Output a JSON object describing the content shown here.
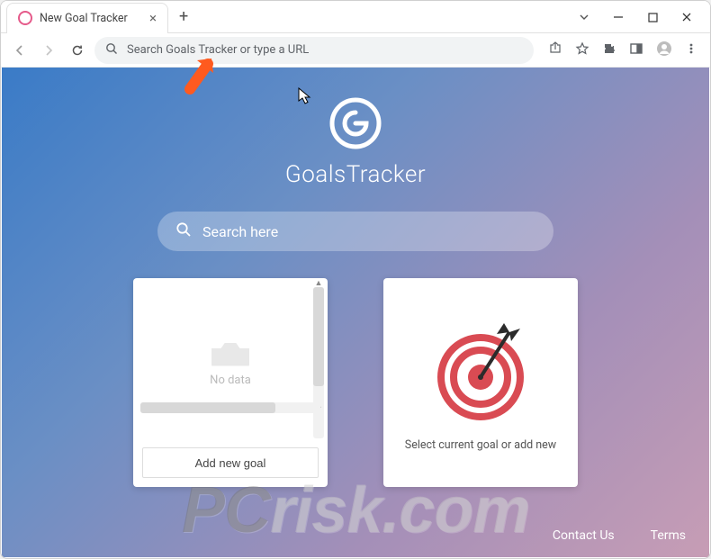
{
  "window": {
    "tab_title": "New Goal Tracker"
  },
  "address_bar": {
    "placeholder": "Search Goals Tracker or type a URL"
  },
  "page": {
    "brand_name": "GoalsTracker",
    "search_placeholder": "Search here"
  },
  "left_card": {
    "empty_label": "No data",
    "add_button": "Add new goal"
  },
  "right_card": {
    "prompt": "Select current goal or add new"
  },
  "footer": {
    "contact": "Contact Us",
    "terms": "Terms"
  },
  "watermark": {
    "prefix": "PC",
    "suffix": "risk.com"
  },
  "colors": {
    "accent_red": "#d94b53",
    "gradient_start": "#3a7bc7",
    "gradient_end": "#c79db5"
  }
}
